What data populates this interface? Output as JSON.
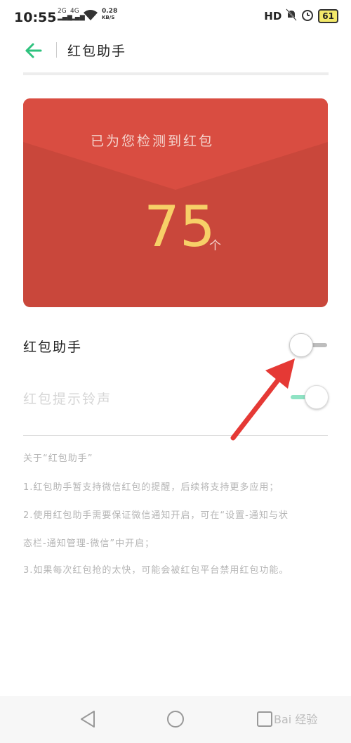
{
  "status_bar": {
    "time": "10:55",
    "signal1": "2G",
    "signal2": "4G",
    "speed_value": "0.28",
    "speed_unit": "KB/S",
    "hd": "HD",
    "battery": "61"
  },
  "header": {
    "title": "红包助手"
  },
  "card": {
    "message": "已为您检测到红包",
    "count": "75",
    "unit": "个"
  },
  "settings": {
    "assistant_label": "红包助手",
    "assistant_enabled": false,
    "ringtone_label": "红包提示铃声",
    "ringtone_enabled": true
  },
  "about": {
    "heading": "关于“红包助手”",
    "line1": "1.红包助手暂支持微信红包的提醒，后续将支持更多应用；",
    "line2a": "2.使用红包助手需要保证微信通知开启，可在“设置-通知与状",
    "line2b": "态栏-通知管理-微信”中开启；",
    "line3": "3.如果每次红包抢的太快，可能会被红包平台禁用红包功能。"
  },
  "watermark": "Bai 经验",
  "colors": {
    "card_red": "#c9473b",
    "count_yellow": "#f7d068",
    "back_green": "#2ec27e",
    "toggle_on": "#8fe3c4",
    "arrow_red": "#e53935"
  }
}
